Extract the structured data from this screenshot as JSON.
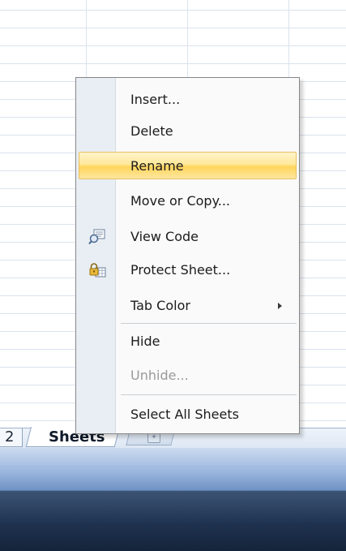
{
  "spreadsheet": {
    "prev_sheet_tab_label": "2",
    "active_sheet_tab_label": "Sheets"
  },
  "context_menu": {
    "items": [
      {
        "label": "Insert...",
        "enabled": true
      },
      {
        "label": "Delete",
        "enabled": true
      },
      {
        "label": "Rename",
        "enabled": true,
        "highlighted": true
      },
      {
        "label": "Move or Copy...",
        "enabled": true
      },
      {
        "label": "View Code",
        "enabled": true,
        "icon": "view-code-icon"
      },
      {
        "label": "Protect Sheet...",
        "enabled": true,
        "icon": "protect-sheet-icon"
      },
      {
        "label": "Tab Color",
        "enabled": true,
        "has_submenu": true
      },
      {
        "label": "Hide",
        "enabled": true
      },
      {
        "label": "Unhide...",
        "enabled": false
      },
      {
        "label": "Select All Sheets",
        "enabled": true
      }
    ]
  },
  "colors": {
    "highlight": "#ffe89a",
    "menu_background": "#fafafa",
    "gutter": "#e9eef4",
    "disabled_text": "#9a9a9a"
  }
}
